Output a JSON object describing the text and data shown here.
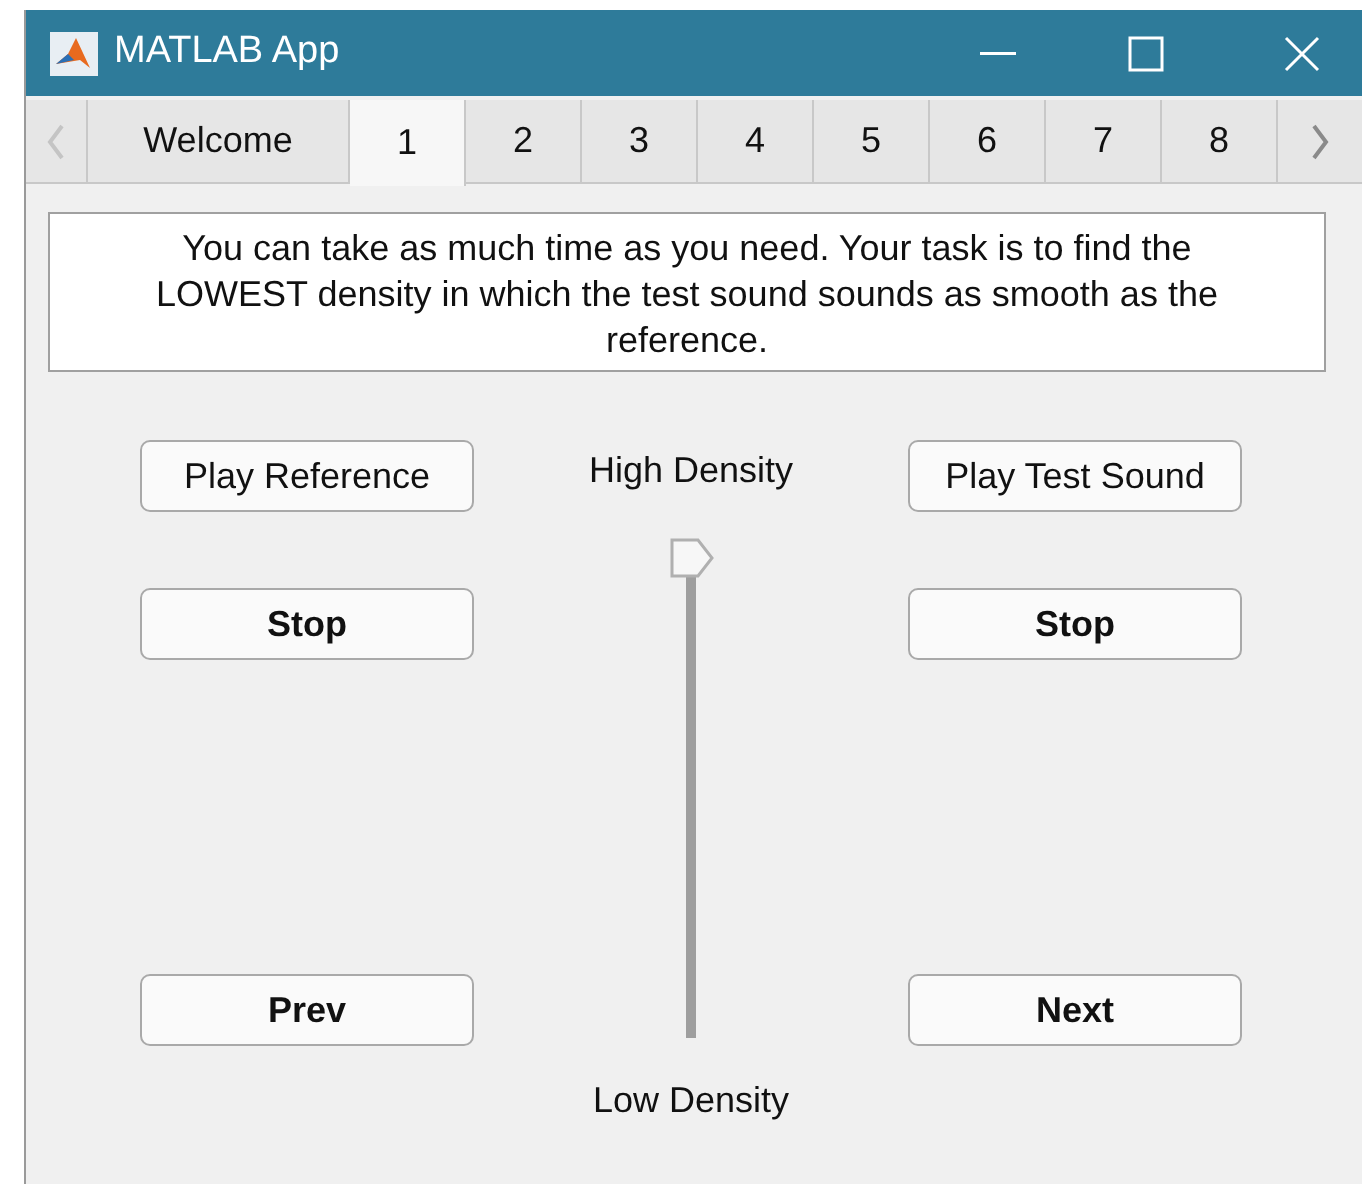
{
  "window": {
    "title": "MATLAB App"
  },
  "tabs": [
    {
      "label": "Welcome",
      "selected": false
    },
    {
      "label": "1",
      "selected": true
    },
    {
      "label": "2",
      "selected": false
    },
    {
      "label": "3",
      "selected": false
    },
    {
      "label": "4",
      "selected": false
    },
    {
      "label": "5",
      "selected": false
    },
    {
      "label": "6",
      "selected": false
    },
    {
      "label": "7",
      "selected": false
    },
    {
      "label": "8",
      "selected": false
    }
  ],
  "instructions": "You can take as much time as you need. Your task is to find the LOWEST density in which the test sound sounds as smooth as the reference.",
  "left_buttons": [
    "Play Reference",
    "Stop",
    "Prev"
  ],
  "right_buttons": [
    "Play Test Sound",
    "Stop",
    "Next"
  ],
  "slider": {
    "top_label": "High Density",
    "bottom_label": "Low Density",
    "level": 1
  }
}
